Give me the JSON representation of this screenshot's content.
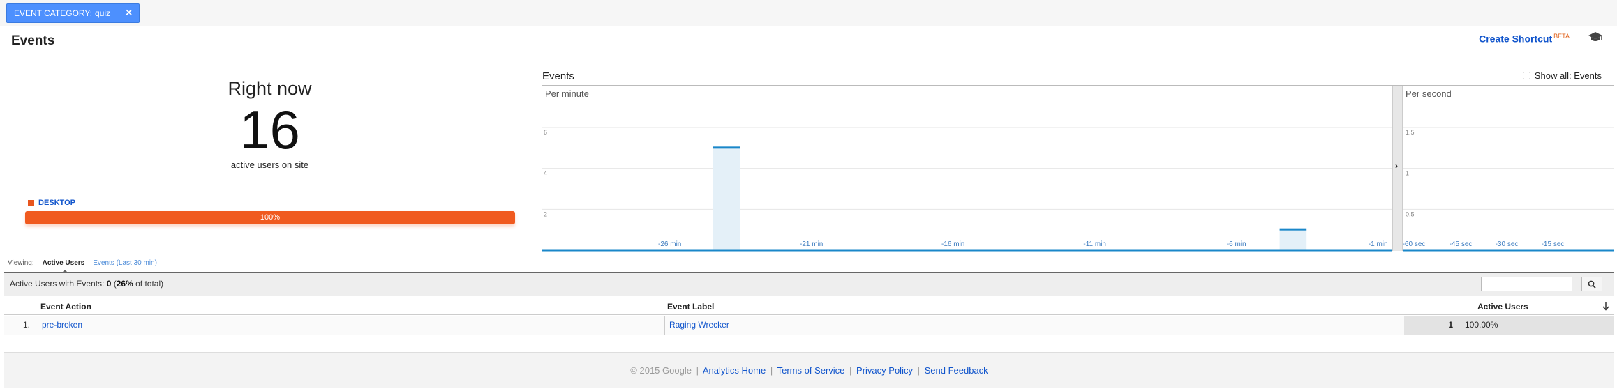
{
  "filter": {
    "label": "EVENT CATEGORY:",
    "value": "quiz",
    "close": "×"
  },
  "header": {
    "title": "Events",
    "shortcut_label": "Create Shortcut",
    "shortcut_badge": "BETA"
  },
  "right_now": {
    "heading": "Right now",
    "count": "16",
    "sub": "active users on site"
  },
  "device": {
    "label": "DESKTOP",
    "percent_label": "100%",
    "percent": 100,
    "color": "#e8561f"
  },
  "chart_header": {
    "title": "Events",
    "show_all": "Show all: Events"
  },
  "chart_data": [
    {
      "type": "bar",
      "panel": "Per minute",
      "y_ticks": [
        "2",
        "4",
        "6"
      ],
      "ylim": [
        0,
        6
      ],
      "x_tick_labels": [
        "-26 min",
        "-21 min",
        "-16 min",
        "-11 min",
        "-6 min",
        "-1 min"
      ],
      "minutes": [
        -30,
        -29,
        -28,
        -27,
        -26,
        -25,
        -24,
        -23,
        -22,
        -21,
        -20,
        -19,
        -18,
        -17,
        -16,
        -15,
        -14,
        -13,
        -12,
        -11,
        -10,
        -9,
        -8,
        -7,
        -6,
        -5,
        -4,
        -3,
        -2,
        -1
      ],
      "values": [
        0,
        0,
        0,
        0,
        0,
        0,
        5,
        0,
        0,
        0,
        0,
        0,
        0,
        0,
        0,
        0,
        0,
        0,
        0,
        0,
        0,
        0,
        0,
        0,
        0,
        0,
        1,
        0,
        0,
        0
      ]
    },
    {
      "type": "bar",
      "panel": "Per second",
      "y_ticks": [
        "0.5",
        "1",
        "1.5"
      ],
      "ylim": [
        0,
        1.5
      ],
      "x_tick_labels": [
        "-60 sec",
        "-45 sec",
        "-30 sec",
        "-15 sec"
      ],
      "values": []
    }
  ],
  "viewing": {
    "label": "Viewing:",
    "active": "Active Users",
    "other": "Events (Last 30 min)"
  },
  "table": {
    "summary_prefix": "Active Users with Events:",
    "summary_value": "0",
    "summary_pct": "26%",
    "summary_suffix": "of total)",
    "columns": [
      "Event Action",
      "Event Label",
      "Active Users"
    ],
    "rows": [
      {
        "index": "1.",
        "action": "pre-broken",
        "label": "Raging Wrecker",
        "users": "1",
        "pct": "100.00%"
      }
    ]
  },
  "footer": {
    "copyright": "© 2015 Google",
    "links": [
      "Analytics Home",
      "Terms of Service",
      "Privacy Policy",
      "Send Feedback"
    ]
  },
  "colors": {
    "accent": "#15c",
    "bar": "#1a87c9",
    "bar_fill": "#e4f0f8",
    "device": "#f05a1f",
    "filter": "#4d90fe"
  }
}
